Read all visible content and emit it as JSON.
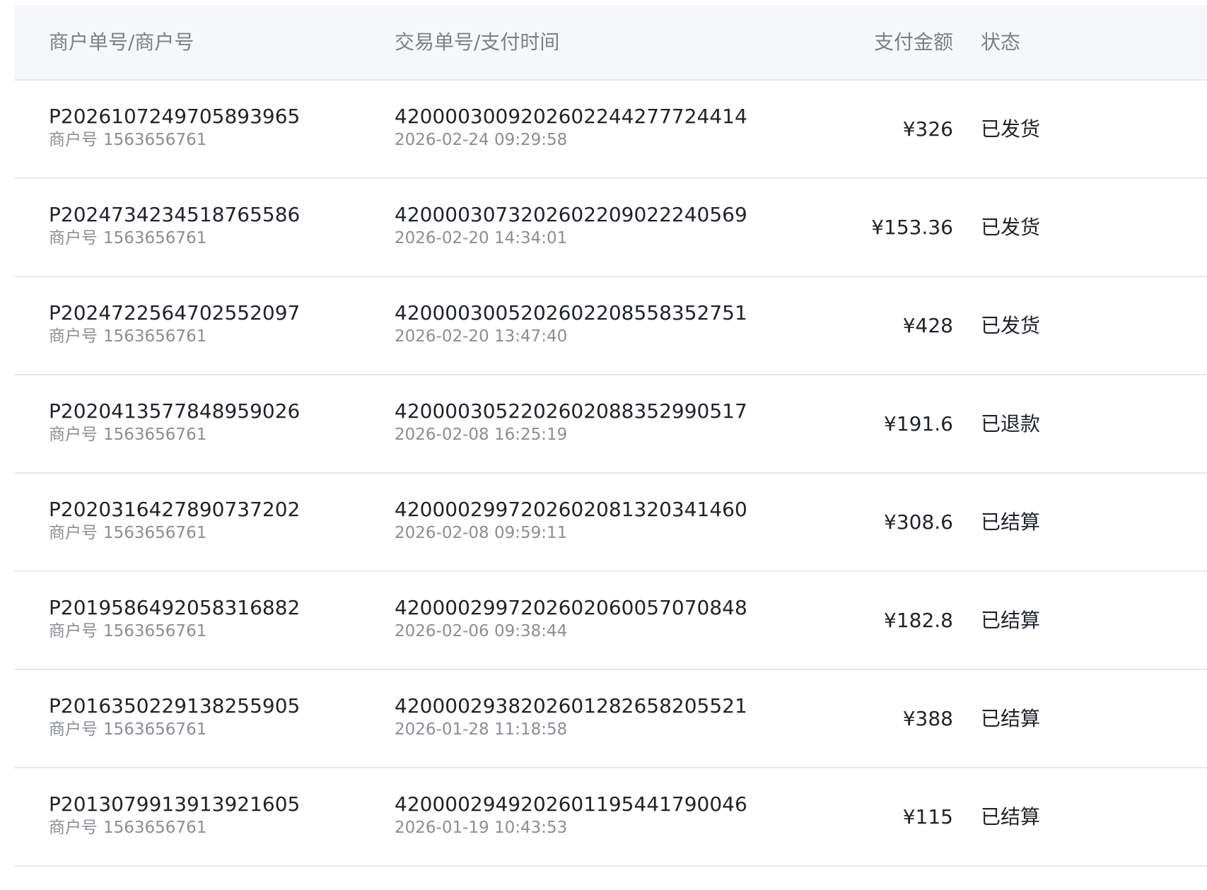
{
  "table": {
    "headers": {
      "merchant": "商户单号/商户号",
      "trade": "交易单号/支付时间",
      "amount": "支付金额",
      "status": "状态"
    },
    "merchant_prefix": "商户号",
    "rows": [
      {
        "order_no": "P2026107249705893965",
        "merchant_id": "1563656761",
        "trade_no": "4200003009202602244277724414",
        "pay_time": "2026-02-24 09:29:58",
        "amount": "¥326",
        "status": "已发货"
      },
      {
        "order_no": "P2024734234518765586",
        "merchant_id": "1563656761",
        "trade_no": "4200003073202602209022240569",
        "pay_time": "2026-02-20 14:34:01",
        "amount": "¥153.36",
        "status": "已发货"
      },
      {
        "order_no": "P2024722564702552097",
        "merchant_id": "1563656761",
        "trade_no": "4200003005202602208558352751",
        "pay_time": "2026-02-20 13:47:40",
        "amount": "¥428",
        "status": "已发货"
      },
      {
        "order_no": "P2020413577848959026",
        "merchant_id": "1563656761",
        "trade_no": "4200003052202602088352990517",
        "pay_time": "2026-02-08 16:25:19",
        "amount": "¥191.6",
        "status": "已退款"
      },
      {
        "order_no": "P2020316427890737202",
        "merchant_id": "1563656761",
        "trade_no": "4200002997202602081320341460",
        "pay_time": "2026-02-08 09:59:11",
        "amount": "¥308.6",
        "status": "已结算"
      },
      {
        "order_no": "P2019586492058316882",
        "merchant_id": "1563656761",
        "trade_no": "4200002997202602060057070848",
        "pay_time": "2026-02-06 09:38:44",
        "amount": "¥182.8",
        "status": "已结算"
      },
      {
        "order_no": "P2016350229138255905",
        "merchant_id": "1563656761",
        "trade_no": "4200002938202601282658205521",
        "pay_time": "2026-01-28 11:18:58",
        "amount": "¥388",
        "status": "已结算"
      },
      {
        "order_no": "P2013079913913921605",
        "merchant_id": "1563656761",
        "trade_no": "4200002949202601195441790046",
        "pay_time": "2026-01-19 10:43:53",
        "amount": "¥115",
        "status": "已结算"
      }
    ]
  }
}
